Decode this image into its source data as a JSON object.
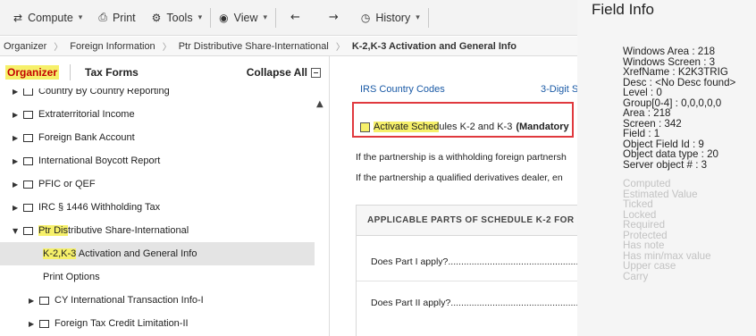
{
  "toolbar": {
    "compute": "Compute",
    "print": "Print",
    "tools": "Tools",
    "view": "View",
    "history": "History"
  },
  "breadcrumb": [
    "Organizer",
    "Foreign Information",
    "Ptr Distributive Share-International",
    "K-2,K-3 Activation and General Info"
  ],
  "left_panel": {
    "tab_organizer": "Organizer",
    "tab_tax_forms": "Tax Forms",
    "collapse_all": "Collapse All",
    "items": [
      {
        "label": "Country By Country Reporting"
      },
      {
        "label": "Extraterritorial Income"
      },
      {
        "label": "Foreign Bank Account"
      },
      {
        "label": "International Boycott Report"
      },
      {
        "label": "PFIC or QEF"
      },
      {
        "label": "IRC § 1446 Withholding Tax"
      },
      {
        "label_hl": "Ptr Dis",
        "label_rest": "tributive Share-International"
      },
      {
        "label_hl": "K-2,K-3",
        "label_rest": " Activation and General Info"
      },
      {
        "label": "Print Options"
      },
      {
        "label": "CY International Transaction Info-I"
      },
      {
        "label": "Foreign Tax Credit Limitation-II"
      }
    ]
  },
  "main": {
    "link_irs": "IRS Country Codes",
    "link_3digit": "3-Digit S",
    "activate_hl": "Activate Sched",
    "activate_rest": "ules K-2 and K-3",
    "activate_mandatory": "(Mandatory",
    "text_withholding": "If the partnership is a withholding foreign partnersh",
    "text_qualified": "If the partnership a qualified derivatives dealer, en",
    "parts_title": "APPLICABLE PARTS OF SCHEDULE K-2 FOR",
    "part1": "Does Part I apply?.......................................................",
    "part2": "Does Part II apply?......................................................"
  },
  "field_info": {
    "title": "Field Info",
    "lines": [
      "Windows Area : 218",
      "Windows Screen : 3",
      "XrefName : K2K3TRIG",
      "Desc : <No Desc found>",
      "Level : 0",
      "Group[0-4] : 0,0,0,0,0",
      "Area : 218",
      "Screen : 342",
      "Field : 1",
      "Object Field Id : 9",
      "Object data type : 20",
      "Server object # : 3"
    ],
    "flags": [
      "Computed",
      "Estimated Value",
      "Ticked",
      "Locked",
      "Required",
      "Protected",
      "Has note",
      "Has min/max value",
      "Upper case",
      "Carry"
    ]
  },
  "colors": {
    "highlight": "#f6f06a",
    "red_box": "#e0393e",
    "link": "#1a5aa6",
    "organizer_tab_text": "#c40000"
  }
}
